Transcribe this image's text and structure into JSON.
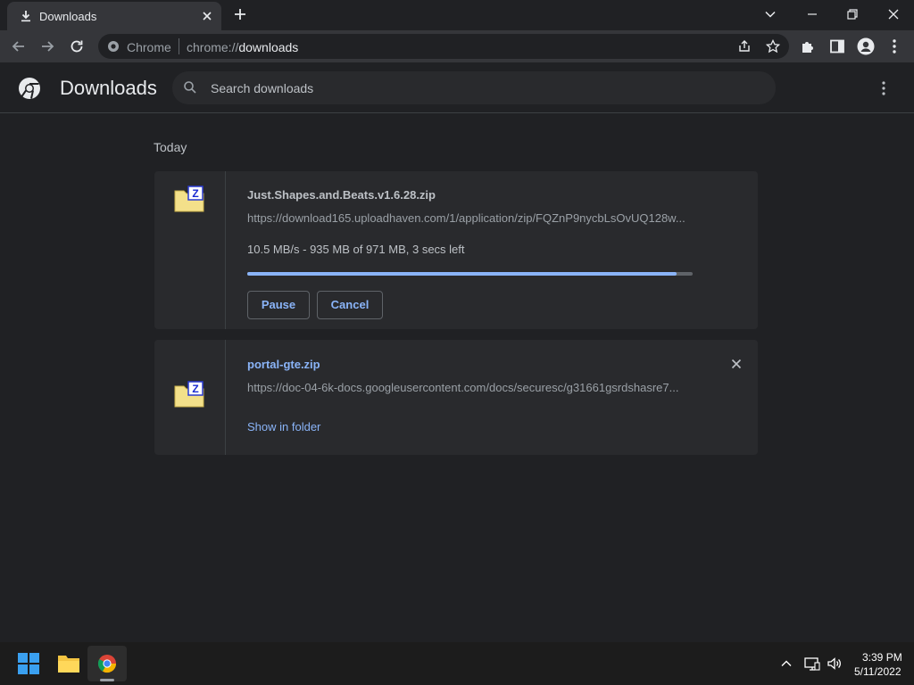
{
  "tab": {
    "title": "Downloads"
  },
  "omnibox": {
    "scheme_label": "Chrome",
    "url_prefix": "chrome://",
    "url_host": "downloads"
  },
  "page": {
    "title": "Downloads",
    "search_placeholder": "Search downloads"
  },
  "downloads": {
    "date_heading": "Today",
    "items": [
      {
        "filename": "Just.Shapes.and.Beats.v1.6.28.zip",
        "url": "https://download165.uploadhaven.com/1/application/zip/FQZnP9nycbLsOvUQ128w...",
        "status": "10.5 MB/s - 935 MB of 971 MB, 3 secs left",
        "progress_fraction": 0.963,
        "pause_label": "Pause",
        "cancel_label": "Cancel"
      },
      {
        "filename": "portal-gte.zip",
        "url": "https://doc-04-6k-docs.googleusercontent.com/docs/securesc/g31661gsrdshasre7...",
        "show_in_folder_label": "Show in folder"
      }
    ]
  },
  "taskbar": {
    "time": "3:39 PM",
    "date": "5/11/2022"
  },
  "colors": {
    "accent": "#8ab4f8",
    "background": "#202124",
    "card": "#292a2d"
  }
}
